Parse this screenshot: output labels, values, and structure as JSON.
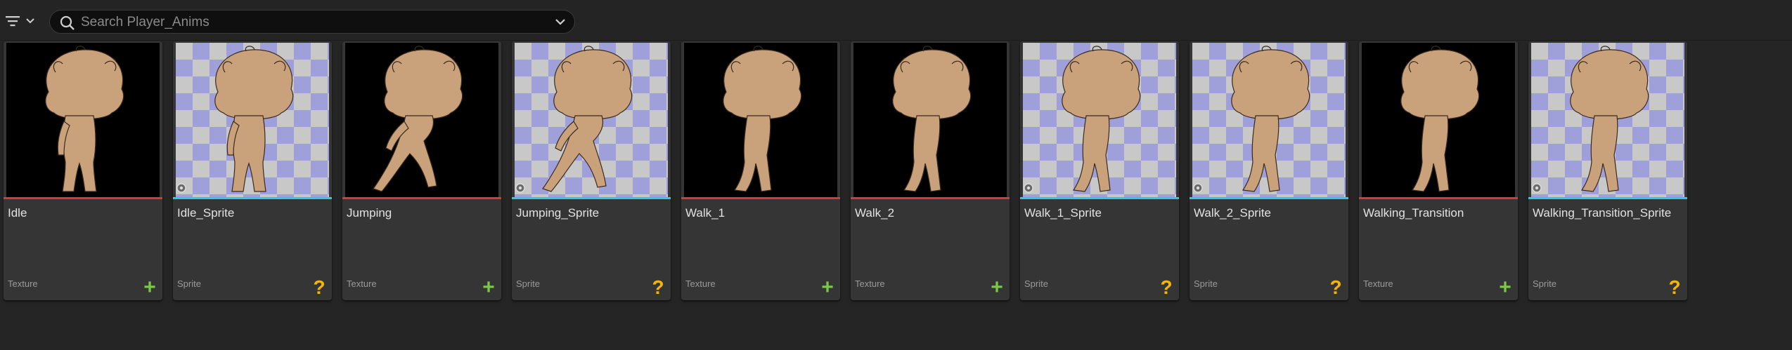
{
  "toolbar": {
    "filter_icon": "filter-icon",
    "search_placeholder": "Search Player_Anims",
    "search_value": ""
  },
  "assets": [
    {
      "name": "Idle",
      "type": "Texture",
      "thumb": "black",
      "badge": "plus",
      "pose": "idle"
    },
    {
      "name": "Idle_Sprite",
      "type": "Sprite",
      "thumb": "checker",
      "badge": "question",
      "pose": "idle"
    },
    {
      "name": "Jumping",
      "type": "Texture",
      "thumb": "black",
      "badge": "plus",
      "pose": "jump"
    },
    {
      "name": "Jumping_Sprite",
      "type": "Sprite",
      "thumb": "checker",
      "badge": "question",
      "pose": "jump"
    },
    {
      "name": "Walk_1",
      "type": "Texture",
      "thumb": "black",
      "badge": "plus",
      "pose": "walk"
    },
    {
      "name": "Walk_2",
      "type": "Texture",
      "thumb": "black",
      "badge": "plus",
      "pose": "walk"
    },
    {
      "name": "Walk_1_Sprite",
      "type": "Sprite",
      "thumb": "checker",
      "badge": "question",
      "pose": "walk"
    },
    {
      "name": "Walk_2_Sprite",
      "type": "Sprite",
      "thumb": "checker",
      "badge": "question",
      "pose": "walk"
    },
    {
      "name": "Walking_Transition",
      "type": "Texture",
      "thumb": "black",
      "badge": "plus",
      "pose": "walk"
    },
    {
      "name": "Walking_Transition_Sprite",
      "type": "Sprite",
      "thumb": "checker",
      "badge": "question",
      "pose": "walk"
    }
  ],
  "colors": {
    "texture_bar": "#d4393d",
    "sprite_bar": "#35c6e6",
    "plus_badge": "#7ac943",
    "question_badge": "#f2b705",
    "character_fill": "#c9a27c"
  }
}
